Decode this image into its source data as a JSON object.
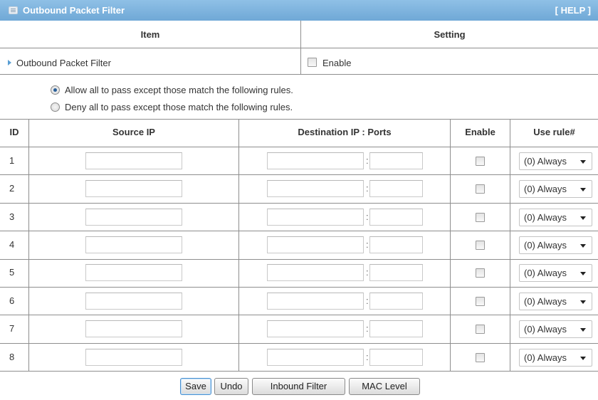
{
  "header": {
    "title": "Outbound Packet Filter",
    "help": "[ HELP ]"
  },
  "settings_table": {
    "col_item": "Item",
    "col_setting": "Setting",
    "row_label": "Outbound Packet Filter",
    "enable_label": "Enable",
    "enable_checked": false
  },
  "policy": {
    "allow_label": "Allow all to pass except those match the following rules.",
    "deny_label": "Deny all to pass except those match the following rules.",
    "selected": "allow"
  },
  "rules_table": {
    "columns": [
      "ID",
      "Source IP",
      "Destination IP : Ports",
      "Enable",
      "Use rule#"
    ],
    "rows": [
      {
        "id": "1",
        "source_ip": "",
        "dest_ip": "",
        "dest_ports": "",
        "enabled": false,
        "rule": "(0) Always"
      },
      {
        "id": "2",
        "source_ip": "",
        "dest_ip": "",
        "dest_ports": "",
        "enabled": false,
        "rule": "(0) Always"
      },
      {
        "id": "3",
        "source_ip": "",
        "dest_ip": "",
        "dest_ports": "",
        "enabled": false,
        "rule": "(0) Always"
      },
      {
        "id": "4",
        "source_ip": "",
        "dest_ip": "",
        "dest_ports": "",
        "enabled": false,
        "rule": "(0) Always"
      },
      {
        "id": "5",
        "source_ip": "",
        "dest_ip": "",
        "dest_ports": "",
        "enabled": false,
        "rule": "(0) Always"
      },
      {
        "id": "6",
        "source_ip": "",
        "dest_ip": "",
        "dest_ports": "",
        "enabled": false,
        "rule": "(0) Always"
      },
      {
        "id": "7",
        "source_ip": "",
        "dest_ip": "",
        "dest_ports": "",
        "enabled": false,
        "rule": "(0) Always"
      },
      {
        "id": "8",
        "source_ip": "",
        "dest_ip": "",
        "dest_ports": "",
        "enabled": false,
        "rule": "(0) Always"
      }
    ],
    "colon": ":"
  },
  "buttons": {
    "save": "Save",
    "undo": "Undo",
    "inbound": "Inbound Filter",
    "mac": "MAC Level"
  },
  "colors": {
    "title_bar": "#7fb4df",
    "accent_arrow": "#5a9fd4",
    "grid_line": "#8e8e8e"
  }
}
